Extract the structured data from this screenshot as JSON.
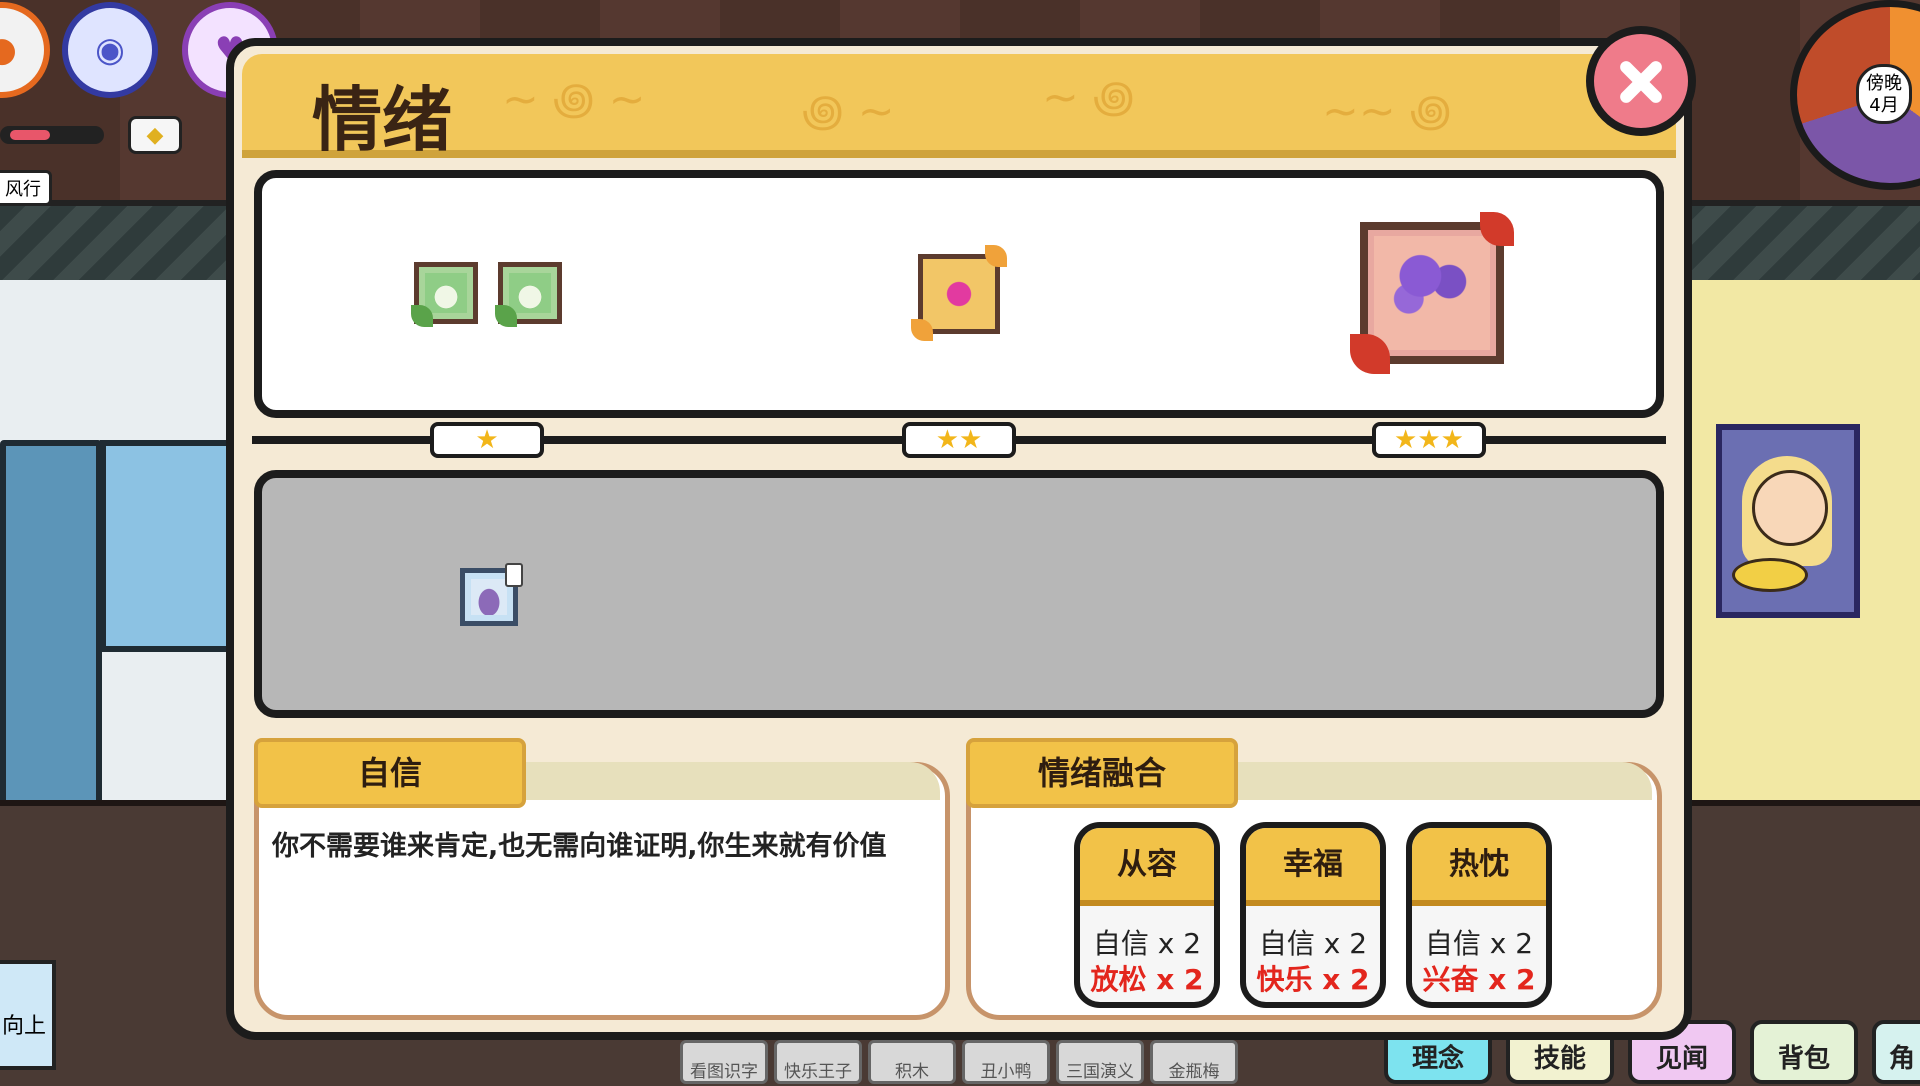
{
  "dialog": {
    "title": "情绪"
  },
  "levels": {
    "one": "★",
    "two": "★★",
    "three": "★★★"
  },
  "selected": {
    "name": "自信",
    "description": "你不需要谁来肯定,也无需向谁证明,你生来就有价值"
  },
  "fusion": {
    "title": "情绪融合",
    "cards": [
      {
        "name": "从容",
        "base": "自信 x 2",
        "extra": "放松 x 2"
      },
      {
        "name": "幸福",
        "base": "自信 x 2",
        "extra": "快乐 x 2"
      },
      {
        "name": "热忱",
        "base": "自信 x 2",
        "extra": "兴奋 x 2"
      }
    ]
  },
  "hud": {
    "tag": "风行",
    "clock_time": "傍晚",
    "clock_month": "4月"
  },
  "bottom_tabs": [
    "看图识字",
    "快乐王子",
    "积木",
    "丑小鸭",
    "三国演义",
    "金瓶梅"
  ],
  "nav": [
    "理念",
    "技能",
    "见闻",
    "背包",
    "角"
  ],
  "left_label": "向上",
  "colors": {
    "accent": "#f2c248",
    "close": "#ef7b8a",
    "red_text": "#e3261d"
  }
}
